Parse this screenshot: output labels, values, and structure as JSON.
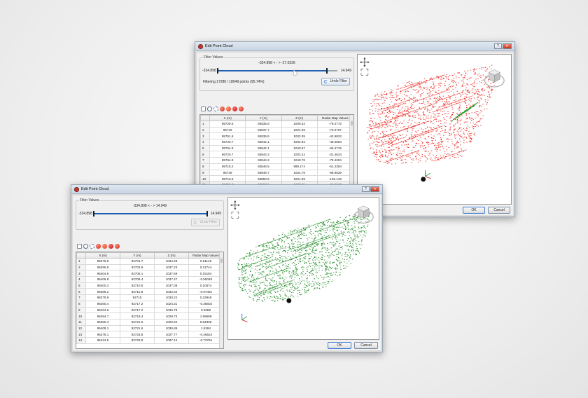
{
  "colors": {
    "red_cloud": "#e8241b",
    "green_cloud": "#1e8a22",
    "highlight_green": "#2f9a2f"
  },
  "back": {
    "title": "Edit Point Cloud",
    "filter_legend": "Filter Values",
    "range_text": "-334.898 < - > -27.0326",
    "min_value": "-334.898",
    "max_value": "14.949",
    "filtering": "Filtering 17280 / 18049 points (95.74%)",
    "undo_label": "Undo Filter",
    "columns": [
      "",
      "X (m)",
      "Y (m)",
      "Z (m)",
      "Radar Map Values"
    ],
    "rows": [
      [
        "1",
        "95729.5",
        "93835.5",
        "1009.34",
        "-79.2772"
      ],
      [
        "2",
        "95745",
        "93837.7",
        "1024.69",
        "-70.2707"
      ],
      [
        "3",
        "95751.6",
        "93839.9",
        "1032.05",
        "-42.6822"
      ],
      [
        "4",
        "95720.7",
        "93842.1",
        "1002.92",
        "-48.0584"
      ],
      [
        "5",
        "95764.9",
        "93842.1",
        "1040.67",
        "-60.4715"
      ],
      [
        "6",
        "95720.7",
        "93844.3",
        "1003.22",
        "-31.4634"
      ],
      [
        "7",
        "95764.9",
        "93844.3",
        "1040.78",
        "-78.4204"
      ],
      [
        "8",
        "95716.2",
        "93846.5",
        "999.174",
        "-61.2354"
      ],
      [
        "9",
        "95736",
        "93848.7",
        "1034.78",
        "-68.9029"
      ],
      [
        "10",
        "95718.5",
        "93850.9",
        "1001.59",
        "-125.142"
      ],
      [
        "11",
        "95762.7",
        "93850.9",
        "1039.35",
        "-96.5347"
      ]
    ],
    "ok_label": "OK",
    "cancel_label": "Cancel",
    "slider_fill_fraction": 0.914
  },
  "front": {
    "title": "Edit Point Cloud",
    "filter_legend": "Filter Values",
    "range_text": "-334.898 < - > 14.949",
    "min_value": "-334.898",
    "max_value": "14.949",
    "undo_label": "Undo Filter",
    "columns": [
      "",
      "X (m)",
      "Y (m)",
      "Z (m)",
      "Radar Map Values"
    ],
    "rows": [
      [
        "1",
        "95375.9",
        "92701.7",
        "1034.28",
        "0.61146"
      ],
      [
        "2",
        "95395.8",
        "92703.9",
        "1037.23",
        "0.21744"
      ],
      [
        "3",
        "95404.6",
        "92706.1",
        "1037.69",
        "0.15184"
      ],
      [
        "4",
        "95406.8",
        "92708.4",
        "1037.47",
        "-0.55048"
      ],
      [
        "5",
        "95400.2",
        "92710.6",
        "1037.09",
        "0.10574"
      ],
      [
        "6",
        "95389.2",
        "92712.8",
        "1032.64",
        "-0.97481"
      ],
      [
        "7",
        "95375.9",
        "92715",
        "1030.22",
        "0.22946"
      ],
      [
        "8",
        "95360.4",
        "92717.2",
        "1024.31",
        "-0.35602"
      ],
      [
        "9",
        "95404.6",
        "92717.2",
        "1036.78",
        "0.2888"
      ],
      [
        "10",
        "95384.7",
        "92719.4",
        "1029.73",
        "1.99699"
      ],
      [
        "11",
        "95360.4",
        "92721.6",
        "1020.64",
        "0.64306"
      ],
      [
        "12",
        "95409.1",
        "92721.6",
        "1036.89",
        "1.5284"
      ],
      [
        "13",
        "95378.1",
        "92723.8",
        "1027.77",
        "-0.46524"
      ],
      [
        "14",
        "95424.5",
        "92723.8",
        "1037.14",
        "-0.72784"
      ]
    ],
    "ok_label": "OK",
    "cancel_label": "Cancel",
    "slider_fill_fraction": 1.0
  }
}
